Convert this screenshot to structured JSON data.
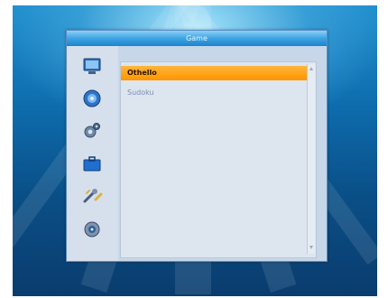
{
  "window": {
    "title": "Game"
  },
  "sidebar": {
    "items": [
      {
        "icon": "tv-icon"
      },
      {
        "icon": "disc-icon"
      },
      {
        "icon": "settings-icon"
      },
      {
        "icon": "toolbox-icon"
      },
      {
        "icon": "tools-icon"
      },
      {
        "icon": "media-icon"
      }
    ]
  },
  "game_list": {
    "items": [
      {
        "label": "Othello",
        "selected": true
      },
      {
        "label": "Sudoku",
        "selected": false
      }
    ]
  },
  "colors": {
    "title_bar": "#3ea3e2",
    "highlight": "#ff9500",
    "panel": "#c7d6e8",
    "background": "#0e6cad"
  }
}
